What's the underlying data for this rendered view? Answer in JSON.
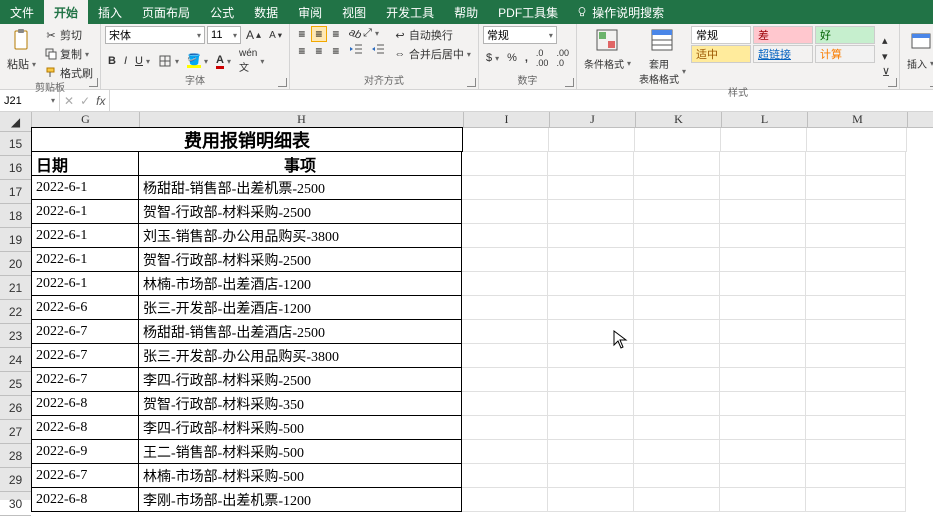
{
  "menu": {
    "file": "文件",
    "tabs": [
      "开始",
      "插入",
      "页面布局",
      "公式",
      "数据",
      "审阅",
      "视图",
      "开发工具",
      "帮助",
      "PDF工具集"
    ],
    "active": 0,
    "search_placeholder": "操作说明搜索"
  },
  "ribbon": {
    "clipboard": {
      "paste": "粘贴",
      "cut": "剪切",
      "copy": "复制",
      "fmt": "格式刷",
      "label": "剪贴板"
    },
    "font": {
      "name": "宋体",
      "size": "11",
      "label": "字体"
    },
    "align": {
      "wrap": "自动换行",
      "merge": "合并后居中",
      "label": "对齐方式"
    },
    "number": {
      "fmt": "常规",
      "label": "数字"
    },
    "styles": {
      "cond": "条件格式",
      "table": "套用\n表格格式",
      "c1": "常规",
      "c2": "差",
      "c3": "好",
      "c4": "适中",
      "c5": "超链接",
      "c6": "计算",
      "label": "样式"
    },
    "insert": {
      "label": "插入"
    }
  },
  "formula_bar": {
    "cell_ref": "J21"
  },
  "grid": {
    "columns": [
      "G",
      "H",
      "I",
      "J",
      "K",
      "L",
      "M"
    ],
    "row_start": 15,
    "title": "费用报销明细表",
    "headers": {
      "g": "日期",
      "h": "事项"
    },
    "rows": [
      {
        "g": "2022-6-1",
        "h": "杨甜甜-销售部-出差机票-2500"
      },
      {
        "g": "2022-6-1",
        "h": "贺智-行政部-材料采购-2500"
      },
      {
        "g": "2022-6-1",
        "h": "刘玉-销售部-办公用品购买-3800"
      },
      {
        "g": "2022-6-1",
        "h": "贺智-行政部-材料采购-2500"
      },
      {
        "g": "2022-6-1",
        "h": "林楠-市场部-出差酒店-1200"
      },
      {
        "g": "2022-6-6",
        "h": "张三-开发部-出差酒店-1200"
      },
      {
        "g": "2022-6-7",
        "h": "杨甜甜-销售部-出差酒店-2500"
      },
      {
        "g": "2022-6-7",
        "h": "张三-开发部-办公用品购买-3800"
      },
      {
        "g": "2022-6-7",
        "h": "李四-行政部-材料采购-2500"
      },
      {
        "g": "2022-6-8",
        "h": "贺智-行政部-材料采购-350"
      },
      {
        "g": "2022-6-8",
        "h": "李四-行政部-材料采购-500"
      },
      {
        "g": "2022-6-9",
        "h": "王二-销售部-材料采购-500"
      },
      {
        "g": "2022-6-7",
        "h": "林楠-市场部-材料采购-500"
      },
      {
        "g": "2022-6-8",
        "h": "李刚-市场部-出差机票-1200"
      }
    ]
  }
}
